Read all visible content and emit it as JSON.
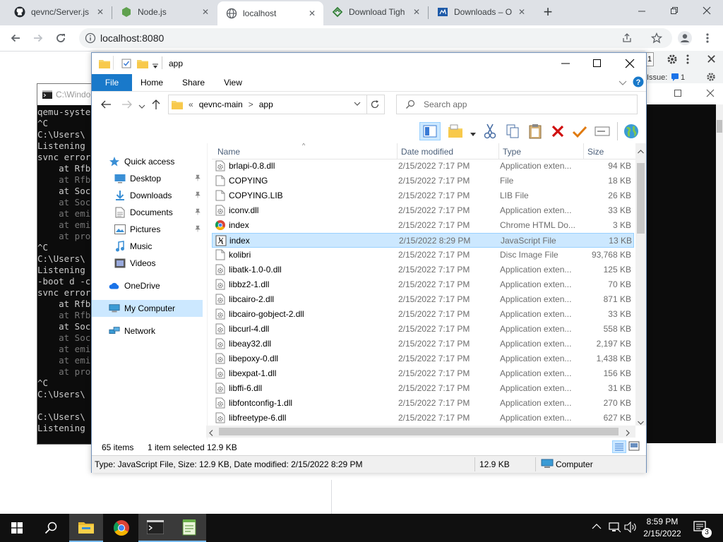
{
  "browser": {
    "tabs": [
      {
        "label": "qevnc/Server.js",
        "icon": "github-icon",
        "close": "✕"
      },
      {
        "label": "Node.js",
        "icon": "nodejs-icon",
        "close": "✕"
      },
      {
        "label": "localhost",
        "icon": "globe-icon",
        "close": "✕",
        "active": true
      },
      {
        "label": "Download Tigh",
        "icon": "tightvnc-icon",
        "close": "✕"
      },
      {
        "label": "Downloads – O",
        "icon": "downloads-page-icon",
        "close": "✕"
      }
    ],
    "new_tab": "+",
    "url": "localhost:8080"
  },
  "devtools": {
    "issue_label": "Issue:",
    "issue_count": "1",
    "left_count": "1"
  },
  "cmd": {
    "title": "C:\\Windo",
    "lines": [
      {
        "text": "qemu-syste",
        "dim": false
      },
      {
        "text": "^C",
        "dim": false
      },
      {
        "text": "C:\\Users\\",
        "dim": false
      },
      {
        "text": "Listening",
        "dim": false
      },
      {
        "text": "svnc error",
        "dim": false
      },
      {
        "text": "    at Rfb",
        "dim": false
      },
      {
        "text": "    at Rfb",
        "dim": true
      },
      {
        "text": "    at Soc",
        "dim": false
      },
      {
        "text": "    at Soc",
        "dim": true
      },
      {
        "text": "    at emi",
        "dim": true
      },
      {
        "text": "    at emi",
        "dim": true
      },
      {
        "text": "    at pro",
        "dim": true
      },
      {
        "text": "^C",
        "dim": false
      },
      {
        "text": "C:\\Users\\",
        "dim": false
      },
      {
        "text": "Listening",
        "dim": false
      },
      {
        "text": "-boot d -c",
        "dim": false
      },
      {
        "text": "svnc error",
        "dim": false
      },
      {
        "text": "    at Rfb",
        "dim": false
      },
      {
        "text": "    at Rfb",
        "dim": true
      },
      {
        "text": "    at Soc",
        "dim": false
      },
      {
        "text": "    at Soc",
        "dim": true
      },
      {
        "text": "    at emi",
        "dim": true
      },
      {
        "text": "    at emi",
        "dim": true
      },
      {
        "text": "    at pro",
        "dim": true
      },
      {
        "text": "^C",
        "dim": false
      },
      {
        "text": "C:\\Users\\",
        "dim": false
      },
      {
        "text": "",
        "dim": false
      },
      {
        "text": "C:\\Users\\",
        "dim": false
      },
      {
        "text": "Listening",
        "dim": false
      }
    ]
  },
  "explorer": {
    "title": "app",
    "ribbon_tabs": [
      "File",
      "Home",
      "Share",
      "View"
    ],
    "breadcrumb": {
      "prefix": "«",
      "parts": [
        "qevnc-main",
        "app"
      ],
      "sep": ">"
    },
    "search_placeholder": "Search app",
    "nav": [
      {
        "label": "Quick access",
        "icon": "star-icon",
        "indent": 0,
        "pinned": false
      },
      {
        "label": "Desktop",
        "icon": "desktop-icon",
        "indent": 1,
        "pinned": true
      },
      {
        "label": "Downloads",
        "icon": "download-icon",
        "indent": 1,
        "pinned": true
      },
      {
        "label": "Documents",
        "icon": "documents-icon",
        "indent": 1,
        "pinned": true
      },
      {
        "label": "Pictures",
        "icon": "pictures-icon",
        "indent": 1,
        "pinned": true
      },
      {
        "label": "Music",
        "icon": "music-icon",
        "indent": 1,
        "pinned": false
      },
      {
        "label": "Videos",
        "icon": "videos-icon",
        "indent": 1,
        "pinned": false
      },
      {
        "label": "OneDrive",
        "icon": "cloud-icon",
        "indent": 0,
        "pinned": false
      },
      {
        "label": "My Computer",
        "icon": "computer-icon",
        "indent": 0,
        "pinned": false,
        "selected": true
      },
      {
        "label": "Network",
        "icon": "network-icon",
        "indent": 0,
        "pinned": false
      }
    ],
    "columns": [
      "Name",
      "Date modified",
      "Type",
      "Size"
    ],
    "files": [
      {
        "name": "brlapi-0.8.dll",
        "date": "2/15/2022 7:17 PM",
        "type": "Application exten...",
        "size": "94 KB",
        "icon": "dll-file-icon"
      },
      {
        "name": "COPYING",
        "date": "2/15/2022 7:17 PM",
        "type": "File",
        "size": "18 KB",
        "icon": "blank-file-icon"
      },
      {
        "name": "COPYING.LIB",
        "date": "2/15/2022 7:17 PM",
        "type": "LIB File",
        "size": "26 KB",
        "icon": "blank-file-icon"
      },
      {
        "name": "iconv.dll",
        "date": "2/15/2022 7:17 PM",
        "type": "Application exten...",
        "size": "33 KB",
        "icon": "dll-file-icon"
      },
      {
        "name": "index",
        "date": "2/15/2022 7:17 PM",
        "type": "Chrome HTML Do...",
        "size": "3 KB",
        "icon": "chrome-file-icon"
      },
      {
        "name": "index",
        "date": "2/15/2022 8:29 PM",
        "type": "JavaScript File",
        "size": "13 KB",
        "icon": "js-file-icon",
        "selected": true
      },
      {
        "name": "kolibri",
        "date": "2/15/2022 7:17 PM",
        "type": "Disc Image File",
        "size": "93,768 KB",
        "icon": "blank-file-icon"
      },
      {
        "name": "libatk-1.0-0.dll",
        "date": "2/15/2022 7:17 PM",
        "type": "Application exten...",
        "size": "125 KB",
        "icon": "dll-file-icon"
      },
      {
        "name": "libbz2-1.dll",
        "date": "2/15/2022 7:17 PM",
        "type": "Application exten...",
        "size": "70 KB",
        "icon": "dll-file-icon"
      },
      {
        "name": "libcairo-2.dll",
        "date": "2/15/2022 7:17 PM",
        "type": "Application exten...",
        "size": "871 KB",
        "icon": "dll-file-icon"
      },
      {
        "name": "libcairo-gobject-2.dll",
        "date": "2/15/2022 7:17 PM",
        "type": "Application exten...",
        "size": "33 KB",
        "icon": "dll-file-icon"
      },
      {
        "name": "libcurl-4.dll",
        "date": "2/15/2022 7:17 PM",
        "type": "Application exten...",
        "size": "558 KB",
        "icon": "dll-file-icon"
      },
      {
        "name": "libeay32.dll",
        "date": "2/15/2022 7:17 PM",
        "type": "Application exten...",
        "size": "2,197 KB",
        "icon": "dll-file-icon"
      },
      {
        "name": "libepoxy-0.dll",
        "date": "2/15/2022 7:17 PM",
        "type": "Application exten...",
        "size": "1,438 KB",
        "icon": "dll-file-icon"
      },
      {
        "name": "libexpat-1.dll",
        "date": "2/15/2022 7:17 PM",
        "type": "Application exten...",
        "size": "156 KB",
        "icon": "dll-file-icon"
      },
      {
        "name": "libffi-6.dll",
        "date": "2/15/2022 7:17 PM",
        "type": "Application exten...",
        "size": "31 KB",
        "icon": "dll-file-icon"
      },
      {
        "name": "libfontconfig-1.dll",
        "date": "2/15/2022 7:17 PM",
        "type": "Application exten...",
        "size": "270 KB",
        "icon": "dll-file-icon"
      },
      {
        "name": "libfreetype-6.dll",
        "date": "2/15/2022 7:17 PM",
        "type": "Application exten...",
        "size": "627 KB",
        "icon": "dll-file-icon"
      }
    ],
    "status": {
      "count": "65 items",
      "selected": "1 item selected",
      "selected_size": "12.9 KB",
      "details": "Type: JavaScript File, Size: 12.9 KB, Date modified: 2/15/2022 8:29 PM",
      "size": "12.9 KB",
      "location": "Computer"
    }
  },
  "taskbar": {
    "time": "8:59 PM",
    "date": "2/15/2022",
    "notifications": "3"
  },
  "colors": {
    "accent": "#1979ca",
    "selection": "#cce8ff",
    "taskbar": "#101010"
  }
}
